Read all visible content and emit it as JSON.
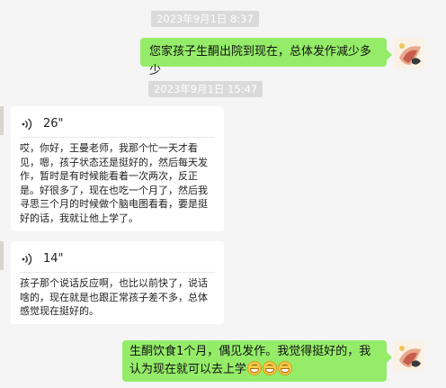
{
  "messages": {
    "ts1": "2023年9月1日 8:37",
    "msg1": "您家孩子生酮出院到现在，总体发作减少多少",
    "ts2": "2023年9月1日 15:47",
    "voice1": {
      "duration": "26\"",
      "transcript": "哎，你好，王曼老师，我那个忙一天才看见，嗯，孩子状态还是挺好的，然后每天发作，暂时是有时候能看着一次两次，反正是。好很多了，现在也吃一个月了，然后我寻思三个月的时候做个脑电图看看，要是挺好的话，我就让他上学了。"
    },
    "voice2": {
      "duration": "14\"",
      "transcript": "孩子那个说话反应啊，也比以前快了，说话啥的，现在就是也跟正常孩子差不多，总体感觉现在挺好的。"
    },
    "msg2": "生酮饮食1个月，偶见发作。我觉得挺好的，我认为现在就可以去上学"
  },
  "icons": {
    "emoji": "grinning-face-emoji",
    "voice": "voice-wave-icon"
  },
  "colors": {
    "self_bubble": "#95ec69",
    "timestamp_bg": "#dadada"
  }
}
